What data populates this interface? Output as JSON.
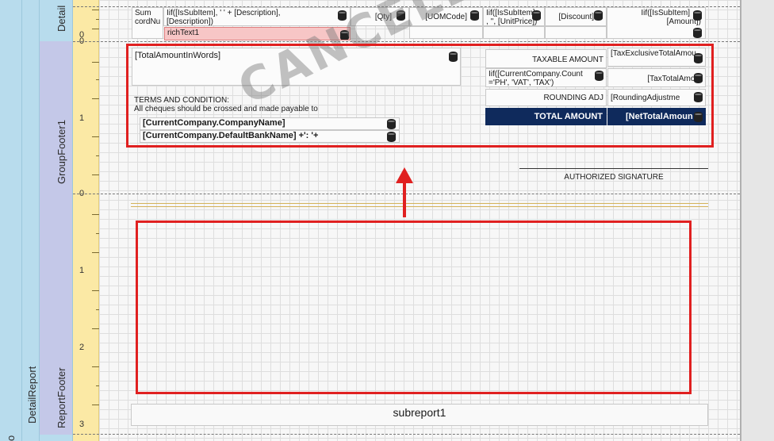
{
  "sections": {
    "detail_report": "DetailReport",
    "detail": "Detail",
    "group_footer": "GroupFooter1",
    "report_footer": "ReportFooter",
    "outer_partial": "o"
  },
  "ruler": {
    "group_footer_marks": [
      "0",
      "1",
      "0"
    ],
    "report_footer_marks": [
      "1",
      "2",
      "3"
    ],
    "detail_marks": [
      "0"
    ]
  },
  "detail_row": {
    "cells": [
      "Sum",
      "cordNu",
      "Iif([IsSubItem], '   ' + [Description],",
      "[Description])",
      "[Qty]",
      "[UOMCode]",
      "Iif([IsSubItem]",
      ", '', [UnitPrice])",
      "[Discount]",
      "Iif([IsSubItem]",
      "[Amount])"
    ],
    "rich_text": "richText1"
  },
  "group_footer": {
    "amount_in_words": "[TotalAmountInWords]",
    "terms_title": "TERMS AND CONDITION:",
    "terms_line": "All cheques should be crossed and made payable to",
    "company_name": "[CurrentCompany.CompanyName]",
    "bank_name": "[CurrentCompany.DefaultBankName] +': '+",
    "taxable_label": "TAXABLE AMOUNT",
    "taxable_value": "[TaxExclusiveTotalAmou",
    "tax_label_line1": "Iif([CurrentCompany.Count",
    "tax_label_line2": "='PH', 'VAT', 'TAX')",
    "tax_value": "[TaxTotalAmou",
    "rounding_label": "ROUNDING ADJ",
    "rounding_value": "[RoundingAdjustme",
    "total_label": "TOTAL AMOUNT",
    "total_value": "[NetTotalAmoun",
    "signature": "AUTHORIZED SIGNATURE"
  },
  "report_footer": {
    "subreport": "subreport1"
  },
  "watermark": "CANCELLED",
  "colors": {
    "highlight": "#e02020",
    "total_bg": "#0f2a5c",
    "band": "#b8dced",
    "ruler": "#fbe9a5"
  }
}
